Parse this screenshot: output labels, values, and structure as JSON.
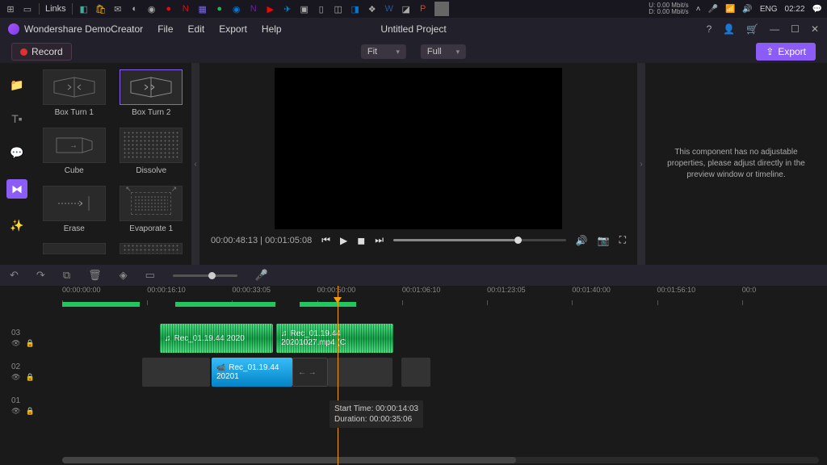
{
  "taskbar": {
    "links_label": "Links",
    "clock": "02:22",
    "lang": "ENG",
    "net_up": "0.00 Mbit/s",
    "net_down": "0.00 Mbit/s",
    "net_u_label": "U:",
    "net_d_label": "D:"
  },
  "app": {
    "name": "Wondershare DemoCreator",
    "menu": {
      "file": "File",
      "edit": "Edit",
      "export": "Export",
      "help": "Help"
    },
    "project": "Untitled Project"
  },
  "toolbar": {
    "record": "Record",
    "fit": "Fit",
    "full": "Full",
    "export": "Export"
  },
  "transitions": [
    {
      "label": "Box Turn 1"
    },
    {
      "label": "Box Turn 2"
    },
    {
      "label": "Cube"
    },
    {
      "label": "Dissolve"
    },
    {
      "label": "Erase"
    },
    {
      "label": "Evaporate 1"
    }
  ],
  "preview": {
    "time": "00:00:48:13 | 00:01:05:08"
  },
  "props": {
    "message": "This component has no adjustable properties, please adjust directly in the preview window or timeline."
  },
  "ruler": [
    "00:00:00:00",
    "00:00:16:10",
    "00:00:33:05",
    "00:00:50:00",
    "00:01:06:10",
    "00:01:23:05",
    "00:01:40:00",
    "00:01:56:10"
  ],
  "tracks": {
    "t3": "03",
    "t2": "02",
    "t1": "01"
  },
  "clips": {
    "audio1": "Rec_01.19.44 2020",
    "audio2": "Rec_01.19.44 20201027.mp4 (C",
    "video1": "Rec_01.19.44 20201"
  },
  "tooltip": {
    "start": "Start Time: 00:00:14:03",
    "dur": "Duration: 00:00:35:06"
  },
  "ruler_end": "00:0"
}
